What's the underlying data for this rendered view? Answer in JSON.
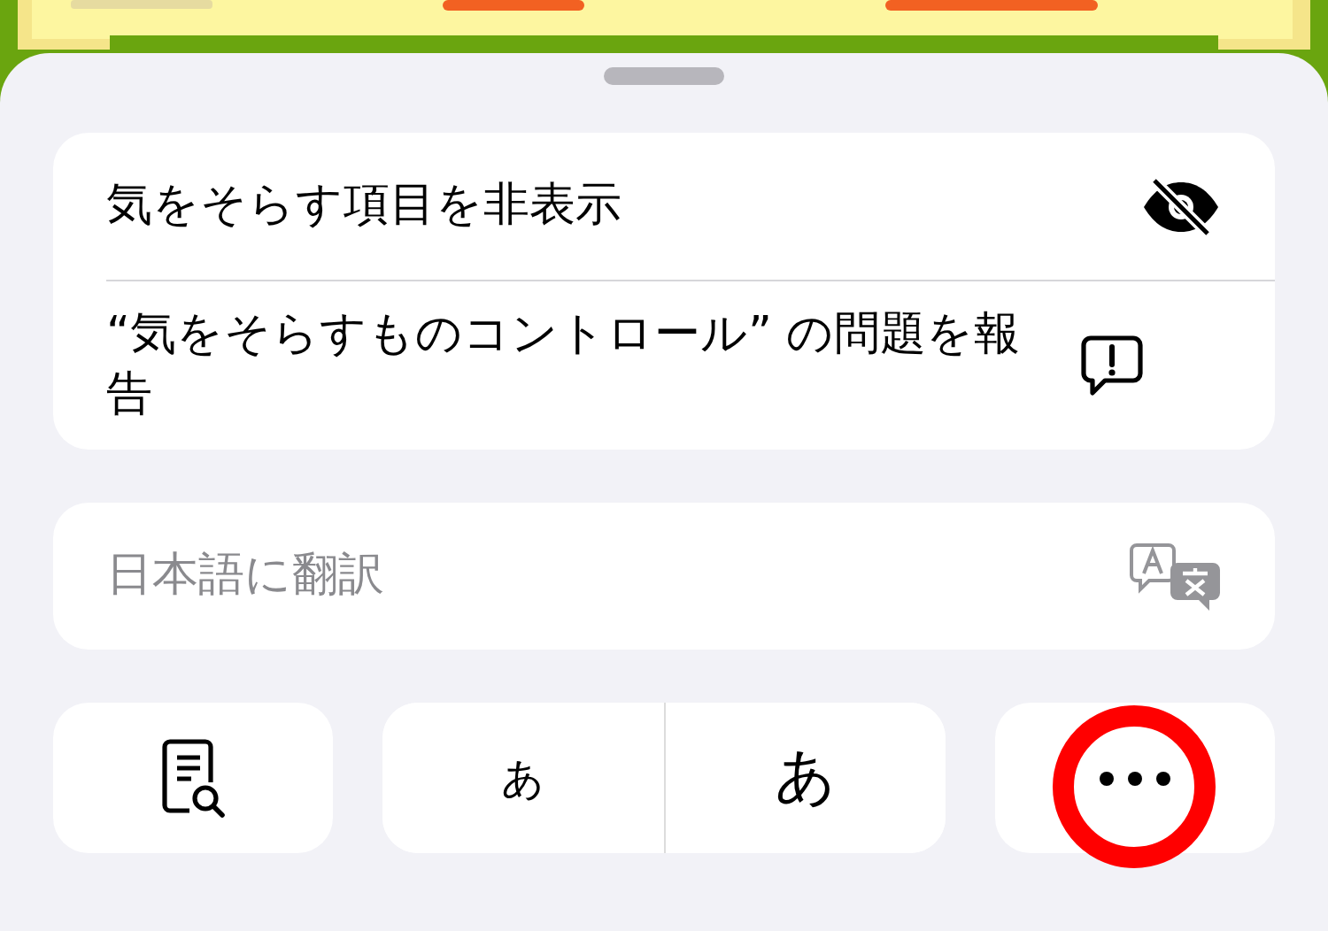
{
  "menu_groups": [
    {
      "items": [
        {
          "label": "気をそらす項目を非表示",
          "kind": "hide",
          "disabled": false
        },
        {
          "label": "“気をそらすものコントロール” の問題を報告",
          "kind": "report",
          "disabled": false
        }
      ]
    },
    {
      "items": [
        {
          "label": "日本語に翻訳",
          "kind": "translate",
          "disabled": true
        }
      ]
    }
  ],
  "toolbar": {
    "text_size": {
      "smaller": "あ",
      "larger": "あ"
    }
  }
}
